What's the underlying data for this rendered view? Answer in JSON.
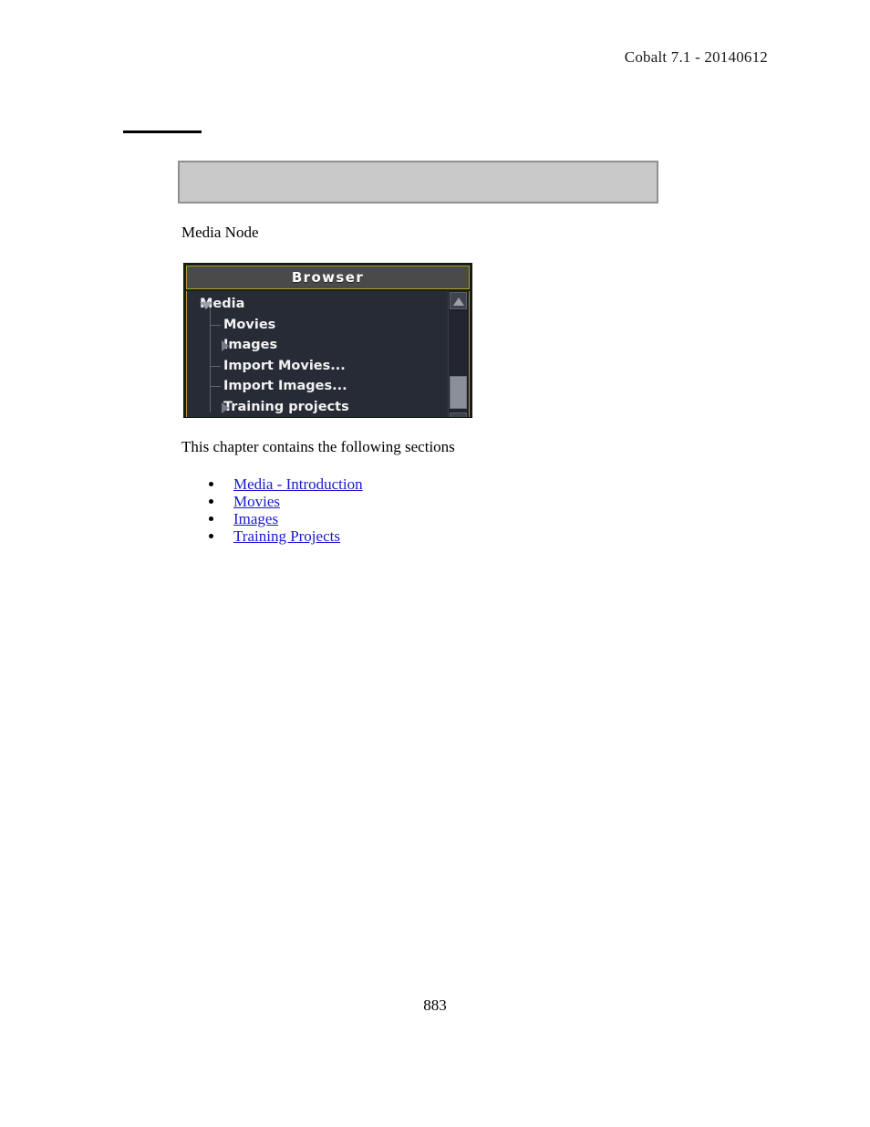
{
  "document": {
    "header": "Cobalt 7.1 - 20140612",
    "page_number": "883",
    "caption": "Media Node",
    "lead_paragraph": "This chapter contains the following sections",
    "banner": {
      "text": "",
      "fill_color": "#c9c9c9",
      "border_color": "#8f8f8f"
    },
    "rule_color": "#000000"
  },
  "links": [
    {
      "label": "Media - Introduction"
    },
    {
      "label": "Movies"
    },
    {
      "label": "Images"
    },
    {
      "label": "Training Projects"
    }
  ],
  "browser_panel": {
    "title": "Browser",
    "accent_color": "#b99a2e",
    "background_color": "#272b36",
    "titlebar_color": "#4a4a4a",
    "text_color": "#f2f2f2",
    "tree": [
      {
        "label": "Media",
        "depth": 0,
        "state": "expanded"
      },
      {
        "label": "Movies",
        "depth": 1,
        "state": "leaf"
      },
      {
        "label": "Images",
        "depth": 1,
        "state": "collapsed"
      },
      {
        "label": "Import Movies...",
        "depth": 1,
        "state": "leaf"
      },
      {
        "label": "Import Images...",
        "depth": 1,
        "state": "leaf"
      },
      {
        "label": "Training projects",
        "depth": 1,
        "state": "collapsed"
      }
    ],
    "scrollbar": {
      "up_arrow": "scroll-up-arrow",
      "thumb_position": "lower"
    }
  }
}
